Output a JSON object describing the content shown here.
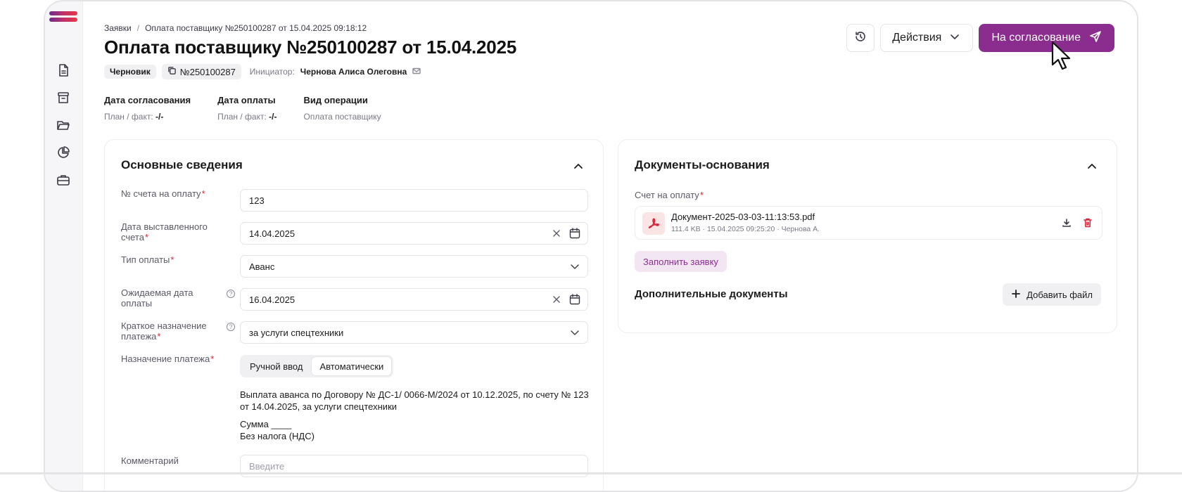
{
  "breadcrumb": {
    "root": "Заявки",
    "sep": "/",
    "current": "Оплата поставщику №250100287 от 15.04.2025 09:18:12"
  },
  "page": {
    "title": "Оплата поставщику №250100287 от 15.04.2025"
  },
  "meta": {
    "status": "Черновик",
    "number": "№250100287",
    "initiator_label": "Инициатор:",
    "initiator_name": "Чернова Алиса Олеговна"
  },
  "actions": {
    "actions_label": "Действия",
    "submit_label": "На согласование"
  },
  "summary": [
    {
      "title": "Дата согласования",
      "prefix": "План / факт:",
      "value": "-/-"
    },
    {
      "title": "Дата оплаты",
      "prefix": "План / факт:",
      "value": "-/-"
    },
    {
      "title": "Вид операции",
      "prefix": "",
      "value": "Оплата поставщику"
    }
  ],
  "main_info": {
    "title": "Основные сведения",
    "invoice_number": {
      "label": "№ счета на оплату",
      "value": "123"
    },
    "invoice_date": {
      "label": "Дата выставленного счета",
      "value": "14.04.2025"
    },
    "payment_type": {
      "label": "Тип оплаты",
      "value": "Аванс"
    },
    "expected_date": {
      "label": "Ожидаемая дата оплаты",
      "value": "16.04.2025"
    },
    "short_purpose": {
      "label": "Краткое назначение платежа",
      "value": "за услуги спецтехники"
    },
    "purpose": {
      "label": "Назначение платежа",
      "mode_manual": "Ручной ввод",
      "mode_auto": "Автоматически",
      "text": "Выплата аванса по Договору № ДС-1/ 0066-М/2024 от 10.12.2025, по счету № 123 от 14.04.2025, за услуги спецтехники",
      "sum_line": "Сумма ____",
      "tax_line": "Без налога (НДС)"
    },
    "comment": {
      "label": "Комментарий",
      "placeholder": "Введите"
    }
  },
  "documents": {
    "title": "Документы-основания",
    "invoice_label": "Счет на оплату",
    "file": {
      "name": "Документ-2025-03-03-11:13:53.pdf",
      "meta": "111.4 KB · 15.04.2025 09:25:20 · Чернова А."
    },
    "fill_button": "Заполнить заявку",
    "extra_title": "Дополнительные документы",
    "add_button": "Добавить файл"
  },
  "colors": {
    "accent": "#8a2d8f",
    "required": "#d6263a"
  }
}
